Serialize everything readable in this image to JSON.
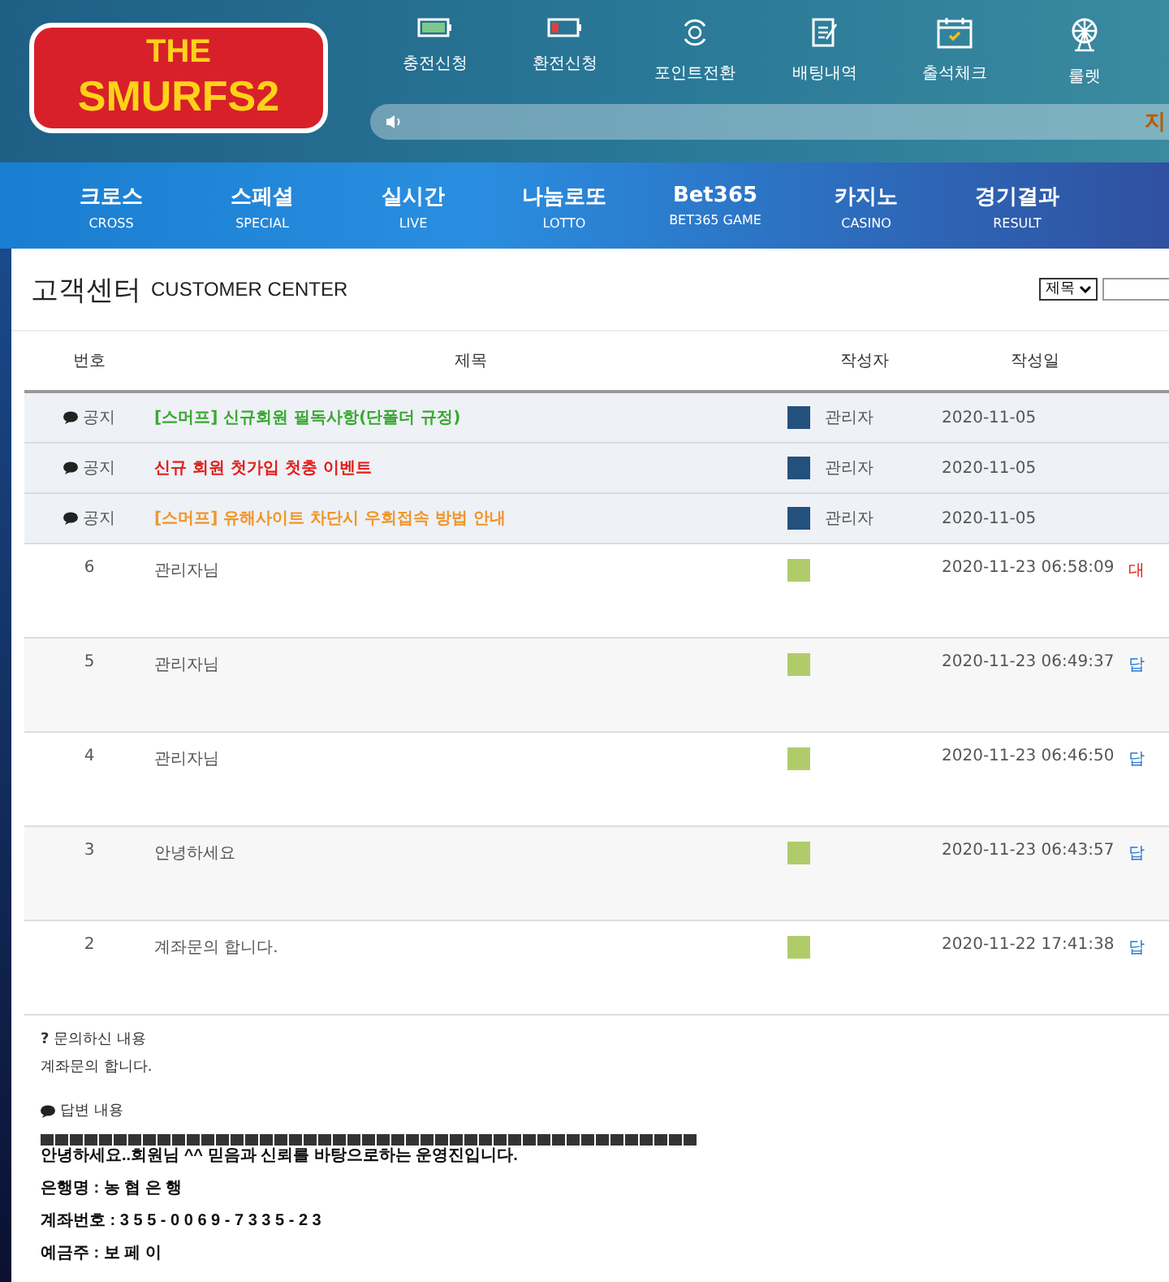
{
  "header": {
    "logo": {
      "line_1": "THE",
      "line_2": "SMURFS2"
    },
    "quick_menu": [
      {
        "label": "충전신청"
      },
      {
        "label": "환전신청"
      },
      {
        "label": "포인트전환"
      },
      {
        "label": "배팅내역"
      },
      {
        "label": "출석체크"
      },
      {
        "label": "룰렛"
      }
    ],
    "marquee": {
      "text": "지"
    }
  },
  "nav": [
    {
      "label": "크로스",
      "sub": "CROSS"
    },
    {
      "label": "스페셜",
      "sub": "SPECIAL"
    },
    {
      "label": "실시간",
      "sub": "LIVE"
    },
    {
      "label": "나눔로또",
      "sub": "LOTTO"
    },
    {
      "label": "Bet365",
      "sub": "BET365 GAME"
    },
    {
      "label": "카지노",
      "sub": "CASINO"
    },
    {
      "label": "경기결과",
      "sub": "RESULT"
    }
  ],
  "page": {
    "title": "고객센터",
    "title_en": "CUSTOMER CENTER",
    "search": {
      "select": "제목"
    }
  },
  "table": {
    "columns": [
      "번호",
      "제목",
      "작성자",
      "작성일"
    ],
    "notices": [
      {
        "badge": "공지",
        "title": "[스머프] 신규회원 필독사항(단폴더 규정)",
        "color": "#3aa832",
        "author": "관리자",
        "date": "2020-11-05"
      },
      {
        "badge": "공지",
        "title": "신규 회원 첫가입 첫충 이벤트",
        "color": "#e0201c",
        "author": "관리자",
        "date": "2020-11-05"
      },
      {
        "badge": "공지",
        "title": "[스머프] 유해사이트 차단시 우회접속 방법 안내",
        "color": "#f0962a",
        "author": "관리자",
        "date": "2020-11-05"
      }
    ],
    "rows": [
      {
        "number": "6",
        "title": "관리자님",
        "date": "2020-11-23 06:58:09",
        "status": "대",
        "color": "#e0201c"
      },
      {
        "number": "5",
        "title": "관리자님",
        "date": "2020-11-23 06:49:37",
        "status": "답",
        "color": "#2a7ad0"
      },
      {
        "number": "4",
        "title": "관리자님",
        "date": "2020-11-23 06:46:50",
        "status": "답",
        "color": "#2a7ad0"
      },
      {
        "number": "3",
        "title": "안녕하세요",
        "date": "2020-11-23 06:43:57",
        "status": "답",
        "color": "#2a7ad0"
      },
      {
        "number": "2",
        "title": "계좌문의 합니다.",
        "date": "2020-11-22 17:41:38",
        "status": "답",
        "color": "#2a7ad0"
      }
    ]
  },
  "detail": {
    "question_mark": "?",
    "question_label": "문의하신 내용",
    "question": "계좌문의 합니다.",
    "answer_label": "답변 내용",
    "answer_lines": [
      "안녕하세요..회원님 ^^ 믿음과 신뢰를 바탕으로하는 운영진입니다.",
      "은행명 : 농 협 은 행",
      "계좌번호 : 3 5 5 - 0 0 6 9 - 7 3 3 5 - 2 3",
      "예금주 :  보 페 이"
    ]
  }
}
